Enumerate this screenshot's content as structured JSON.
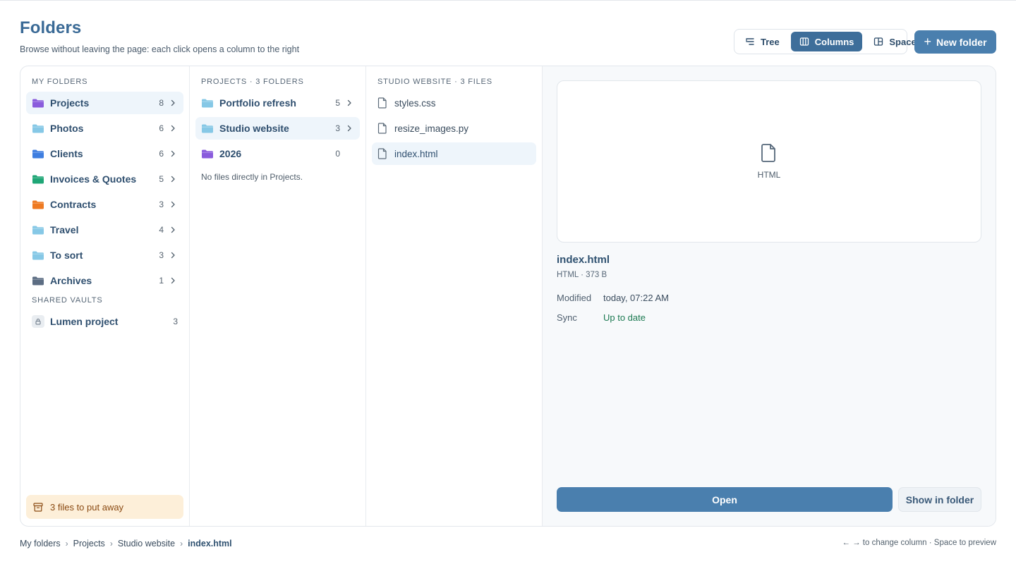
{
  "header": {
    "title": "Folders",
    "subtitle": "Browse without leaving the page: each click opens a column to the right"
  },
  "view_switch": {
    "tree": "Tree",
    "columns": "Columns",
    "space": "Space",
    "active": "Columns"
  },
  "new_folder": {
    "label": "New folder"
  },
  "sidebar": {
    "my_folders_heading": "MY FOLDERS",
    "items": [
      {
        "label": "Projects",
        "count": "8",
        "color": "#8a5cdc",
        "selected": true
      },
      {
        "label": "Photos",
        "count": "6",
        "color": "#86c8e6"
      },
      {
        "label": "Clients",
        "count": "6",
        "color": "#3f7ee0"
      },
      {
        "label": "Invoices & Quotes",
        "count": "5",
        "color": "#1fa676"
      },
      {
        "label": "Contracts",
        "count": "3",
        "color": "#ee7a22"
      },
      {
        "label": "Travel",
        "count": "4",
        "color": "#86c8e6"
      },
      {
        "label": "To sort",
        "count": "3",
        "color": "#86c8e6"
      },
      {
        "label": "Archives",
        "count": "1",
        "color": "#5c6d83"
      }
    ],
    "shared_heading": "SHARED VAULTS",
    "shared": [
      {
        "label": "Lumen project",
        "count": "3"
      }
    ],
    "put_away": "3 files to put away"
  },
  "projects_col": {
    "heading": "PROJECTS · 3 FOLDERS",
    "items": [
      {
        "label": "Portfolio refresh",
        "count": "5",
        "color": "#86c8e6"
      },
      {
        "label": "Studio website",
        "count": "3",
        "color": "#86c8e6",
        "selected": true
      },
      {
        "label": "2026",
        "count": "0",
        "color": "#8a5cdc"
      }
    ],
    "empty_note": "No files directly in Projects."
  },
  "files_col": {
    "heading": "STUDIO WEBSITE · 3 FILES",
    "items": [
      {
        "label": "styles.css"
      },
      {
        "label": "resize_images.py"
      },
      {
        "label": "index.html",
        "selected": true
      }
    ]
  },
  "preview": {
    "type_label": "HTML",
    "name": "index.html",
    "meta": "HTML · 373 B",
    "modified_key": "Modified",
    "modified_val": "today, 07:22 AM",
    "sync_key": "Sync",
    "sync_val": "Up to date",
    "open": "Open",
    "show_in_folder": "Show in folder"
  },
  "breadcrumb": [
    "My folders",
    "Projects",
    "Studio website",
    "index.html"
  ],
  "hint": "← → to change column · Space to preview"
}
